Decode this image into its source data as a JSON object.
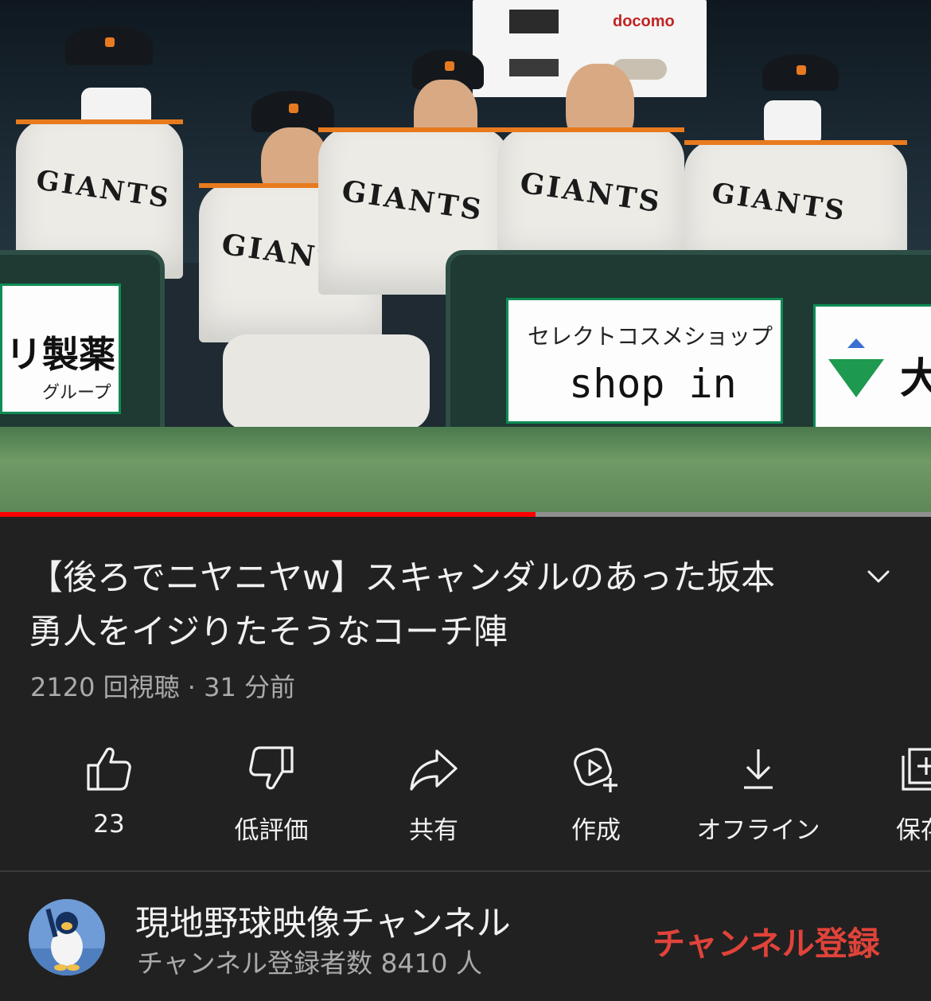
{
  "video": {
    "progress_fraction": 0.575,
    "ad_boards": {
      "left_main": "リ製薬",
      "left_sub": "グループ",
      "center_top": "セレクトコスメショップ",
      "center_main": "shop in",
      "right_main": "大"
    },
    "jersey_text": "GIANTS"
  },
  "title": {
    "text": "【後ろでニヤニヤw】スキャンダルのあった坂本勇人をイジりたそうなコーチ陣"
  },
  "meta": {
    "views": "2120 回視聴",
    "separator": "·",
    "time_ago": "31 分前"
  },
  "actions": [
    {
      "id": "like",
      "label": "23",
      "icon": "thumbs-up-icon"
    },
    {
      "id": "dislike",
      "label": "低評価",
      "icon": "thumbs-down-icon"
    },
    {
      "id": "share",
      "label": "共有",
      "icon": "share-icon"
    },
    {
      "id": "create",
      "label": "作成",
      "icon": "create-icon"
    },
    {
      "id": "offline",
      "label": "オフライン",
      "icon": "download-icon"
    },
    {
      "id": "save",
      "label": "保存",
      "icon": "save-icon"
    }
  ],
  "channel": {
    "name": "現地野球映像チャンネル",
    "subscribers": "チャンネル登録者数 8410 人",
    "subscribe_label": "チャンネル登録"
  },
  "colors": {
    "background": "#212121",
    "progress": "#ff0000",
    "subscribe": "#e0433a",
    "secondary_text": "#aaaaaa"
  }
}
